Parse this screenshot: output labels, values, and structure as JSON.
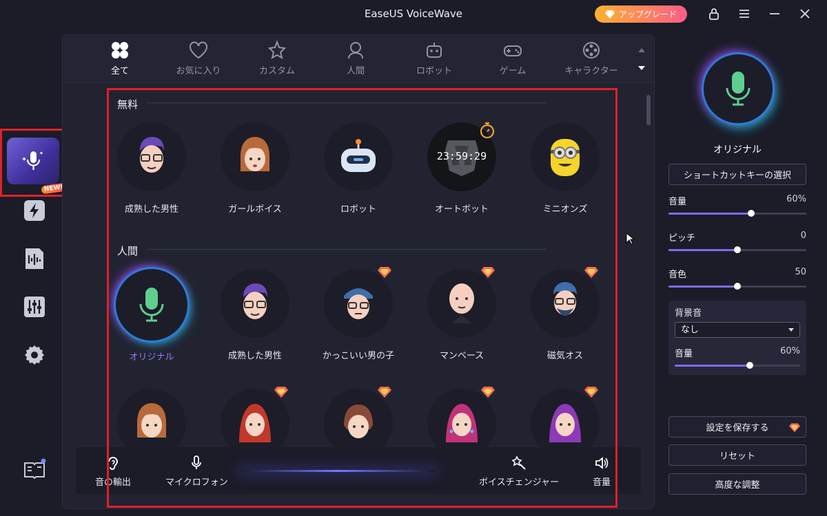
{
  "window": {
    "title": "EaseUS VoiceWave",
    "upgrade_label": "アップグレード"
  },
  "categories": [
    {
      "label": "全て",
      "icon": "grid-icon",
      "active": true
    },
    {
      "label": "お気に入り",
      "icon": "heart-icon",
      "active": false
    },
    {
      "label": "カスタム",
      "icon": "custom-star-icon",
      "active": false
    },
    {
      "label": "人間",
      "icon": "person-icon",
      "active": false
    },
    {
      "label": "ロボット",
      "icon": "robot-icon",
      "active": false
    },
    {
      "label": "ゲーム",
      "icon": "gamepad-icon",
      "active": false
    },
    {
      "label": "キャラクター",
      "icon": "film-reel-icon",
      "active": false
    }
  ],
  "sections": {
    "free": {
      "title": "無料",
      "voices": [
        {
          "label": "成熟した男性",
          "icon": "mature-man-avatar"
        },
        {
          "label": "ガールボイス",
          "icon": "girl-avatar"
        },
        {
          "label": "ロボット",
          "icon": "robot-avatar"
        },
        {
          "label": "オートボット",
          "icon": "autobot-avatar",
          "timer": "23:59:29"
        },
        {
          "label": "ミニオンズ",
          "icon": "minion-avatar"
        }
      ]
    },
    "human": {
      "title": "人間",
      "voices": [
        {
          "label": "オリジナル",
          "icon": "microphone-icon",
          "selected": true
        },
        {
          "label": "成熟した男性",
          "icon": "mature-man-avatar"
        },
        {
          "label": "かっこいい男の子",
          "icon": "cool-boy-avatar",
          "premium": true
        },
        {
          "label": "マンベース",
          "icon": "bald-man-avatar",
          "premium": true
        },
        {
          "label": "磁気オス",
          "icon": "bearded-man-avatar",
          "premium": true
        }
      ],
      "row3": [
        {
          "icon": "bob-girl-avatar"
        },
        {
          "icon": "red-hair-woman-avatar",
          "premium": true
        },
        {
          "icon": "brown-hair-girl-avatar",
          "premium": true
        },
        {
          "icon": "pink-hair-woman-avatar",
          "premium": true
        },
        {
          "icon": "purple-hair-woman-avatar",
          "premium": true
        }
      ]
    }
  },
  "bottom_bar": {
    "output_label": "音の輸出",
    "mic_label": "マイクロフォン",
    "changer_label": "ボイスチェンジャー",
    "volume_label": "音量"
  },
  "right_panel": {
    "current_voice": "オリジナル",
    "shortcut_button": "ショートカットキーの選択",
    "sliders": [
      {
        "label": "音量",
        "value": "60%",
        "fraction": 0.6
      },
      {
        "label": "ピッチ",
        "value": "0",
        "fraction": 0.5
      },
      {
        "label": "音色",
        "value": "50",
        "fraction": 0.5
      }
    ],
    "background": {
      "title": "背景音",
      "selected": "なし",
      "volume_label": "音量",
      "volume_value": "60%",
      "volume_fraction": 0.6
    },
    "save_button": "設定を保存する",
    "reset_button": "リセット",
    "advanced_button": "高度な調整"
  },
  "colors": {
    "accent": "#7d6cf0",
    "highlight_box": "#e0202a",
    "selected_text": "#8a7cff"
  }
}
